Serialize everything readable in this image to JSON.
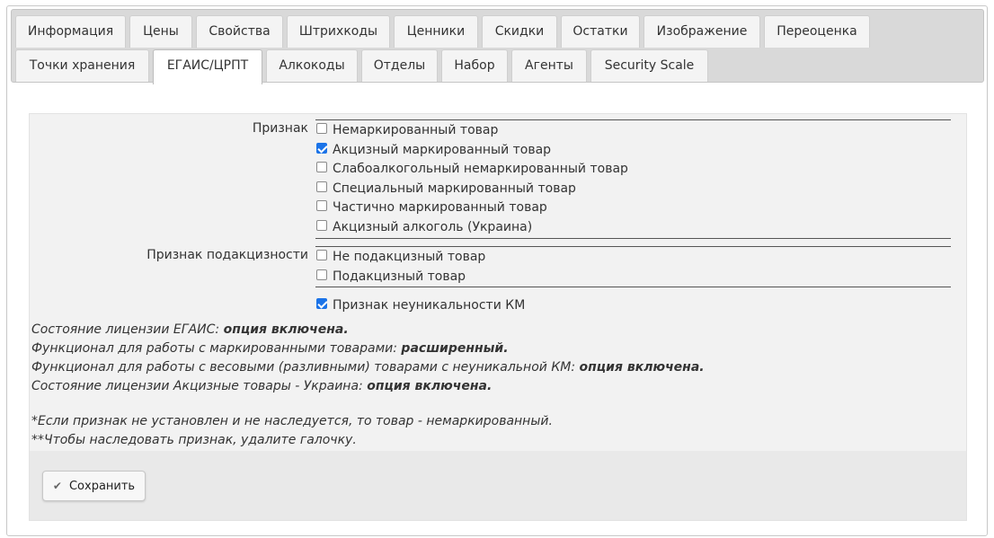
{
  "tabs_row1": [
    "Информация",
    "Цены",
    "Свойства",
    "Штрихкоды",
    "Ценники",
    "Скидки",
    "Остатки",
    "Изображение",
    "Переоценка"
  ],
  "tabs_row2": [
    "Точки хранения",
    "ЕГАИС/ЦРПТ",
    "Алкокоды",
    "Отделы",
    "Набор",
    "Агенты",
    "Security Scale"
  ],
  "active_tab": "ЕГАИС/ЦРПТ",
  "form": {
    "priznak_label": "Признак",
    "priznak_options": [
      {
        "label": "Немаркированный товар",
        "checked": false
      },
      {
        "label": "Акцизный маркированный товар",
        "checked": true
      },
      {
        "label": "Слабоалкогольный немаркированный товар",
        "checked": false
      },
      {
        "label": "Специальный маркированный товар",
        "checked": false
      },
      {
        "label": "Частично маркированный товар",
        "checked": false
      },
      {
        "label": "Акцизный алкоголь (Украина)",
        "checked": false
      }
    ],
    "podakciz_label": "Признак подакцизности",
    "podakciz_options": [
      {
        "label": "Не подакцизный товар",
        "checked": false
      },
      {
        "label": "Подакцизный товар",
        "checked": false
      }
    ],
    "nonunique_label": "Признак неуникальности КМ",
    "nonunique_checked": true
  },
  "info": {
    "line1_text": "Состояние лицензии ЕГАИС: ",
    "line1_value": "опция включена.",
    "line2_text": "Функционал для работы с маркированными товарами: ",
    "line2_value": "расширенный.",
    "line3_text": "Функционал для работы с весовыми (разливными) товарами с неуникальной КМ: ",
    "line3_value": "опция включена.",
    "line4_text": "Состояние лицензии Акцизные товары - Украина: ",
    "line4_value": "опция включена.",
    "note1": "*Если признак не установлен и не наследуется, то товар - немаркированный.",
    "note2": "**Чтобы наследовать признак, удалите галочку."
  },
  "save_label": "Сохранить",
  "colors": {
    "checkbox_checked": "#1b73e8",
    "tabbar_bg": "#d9d9d9",
    "panel_bg": "#f2f2f2"
  }
}
